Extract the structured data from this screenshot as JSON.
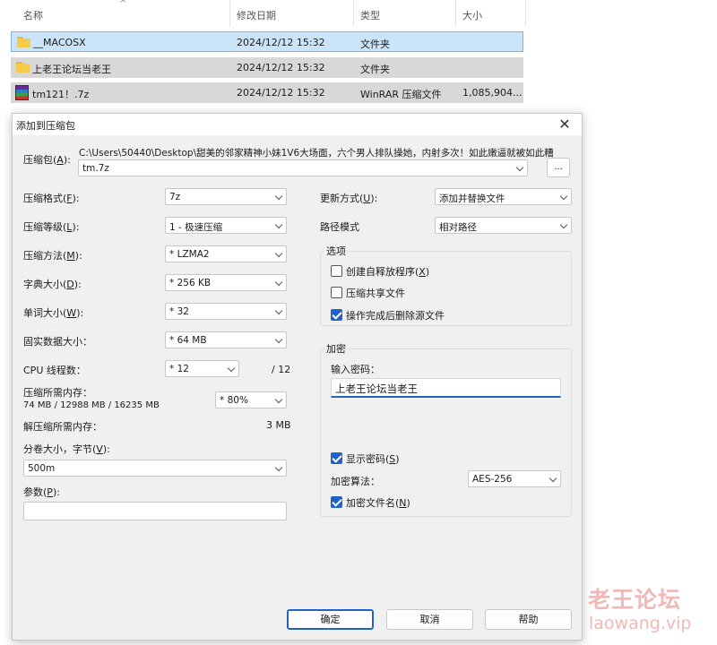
{
  "explorer": {
    "columns": {
      "name": "名称",
      "modified": "修改日期",
      "type": "类型",
      "size": "大小"
    },
    "files": [
      {
        "name": "__MACOSX",
        "modified": "2024/12/12 15:32",
        "type": "文件夹",
        "size": "",
        "icon": "folder-icon"
      },
      {
        "name": "上老王论坛当老王",
        "modified": "2024/12/12 15:32",
        "type": "文件夹",
        "size": "",
        "icon": "folder-icon"
      },
      {
        "name": "tm121！.7z",
        "modified": "2024/12/12 15:32",
        "type": "WinRAR 压缩文件",
        "size": "1,085,904...",
        "icon": "winrar-archive-icon"
      }
    ]
  },
  "dialog": {
    "title": "添加到压缩包",
    "archive": {
      "label_pre": "压缩包(",
      "label_key": "A",
      "label_post": "):",
      "path": "C:\\Users\\50440\\Desktop\\甜美的邻家精神小妹1V6大场面，六个男人排队操她，内射多次！如此嫩逼就被如此糟",
      "filename": "tm.7z",
      "browse": "..."
    },
    "left": {
      "format": {
        "label_pre": "压缩格式(",
        "label_key": "F",
        "label_post": "):",
        "value": "7z"
      },
      "level": {
        "label_pre": "压缩等级(",
        "label_key": "L",
        "label_post": "):",
        "value": "1 - 极速压缩"
      },
      "method": {
        "label_pre": "压缩方法(",
        "label_key": "M",
        "label_post": "):",
        "value": "* LZMA2"
      },
      "dict": {
        "label_pre": "字典大小(",
        "label_key": "D",
        "label_post": "):",
        "value": "* 256 KB"
      },
      "word": {
        "label_pre": "单词大小(",
        "label_key": "W",
        "label_post": "):",
        "value": "* 32"
      },
      "solid": {
        "label": "固实数据大小：",
        "value": "* 64 MB"
      },
      "cpu": {
        "label": "CPU 线程数：",
        "value": "* 12",
        "max": "/ 12"
      },
      "mem_comp": {
        "label": "压缩所需内存：",
        "detail": "74 MB / 12988 MB / 16235 MB",
        "value": "* 80%"
      },
      "mem_decomp": {
        "label": "解压缩所需内存：",
        "value": "3 MB"
      },
      "split": {
        "label_pre": "分卷大小，字节(",
        "label_key": "V",
        "label_post": "):",
        "value": "500m"
      },
      "params": {
        "label_pre": "参数(",
        "label_key": "P",
        "label_post": "):",
        "value": ""
      }
    },
    "right": {
      "update": {
        "label_pre": "更新方式(",
        "label_key": "U",
        "label_post": "):",
        "value": "添加并替换文件"
      },
      "path_mode": {
        "label": "路径模式",
        "value": "相对路径"
      },
      "options": {
        "title": "选项",
        "sfx": {
          "label_pre": "创建自释放程序(",
          "label_key": "X",
          "label_post": ")",
          "checked": false
        },
        "shared": {
          "label": "压缩共享文件",
          "checked": false
        },
        "delete": {
          "label": "操作完成后删除源文件",
          "checked": true
        }
      },
      "encryption": {
        "title": "加密",
        "password_label": "输入密码：",
        "password": "上老王论坛当老王",
        "show_password": {
          "label_pre": "显示密码(",
          "label_key": "S",
          "label_post": ")",
          "checked": true
        },
        "method_label": "加密算法：",
        "method": "AES-256",
        "encrypt_names": {
          "label_pre": "加密文件名(",
          "label_key": "N",
          "label_post": ")",
          "checked": true
        }
      }
    },
    "buttons": {
      "ok": "确定",
      "cancel": "取消",
      "help": "帮助"
    }
  },
  "watermark": {
    "cn": "老王论坛",
    "en": "laowang.vip"
  }
}
